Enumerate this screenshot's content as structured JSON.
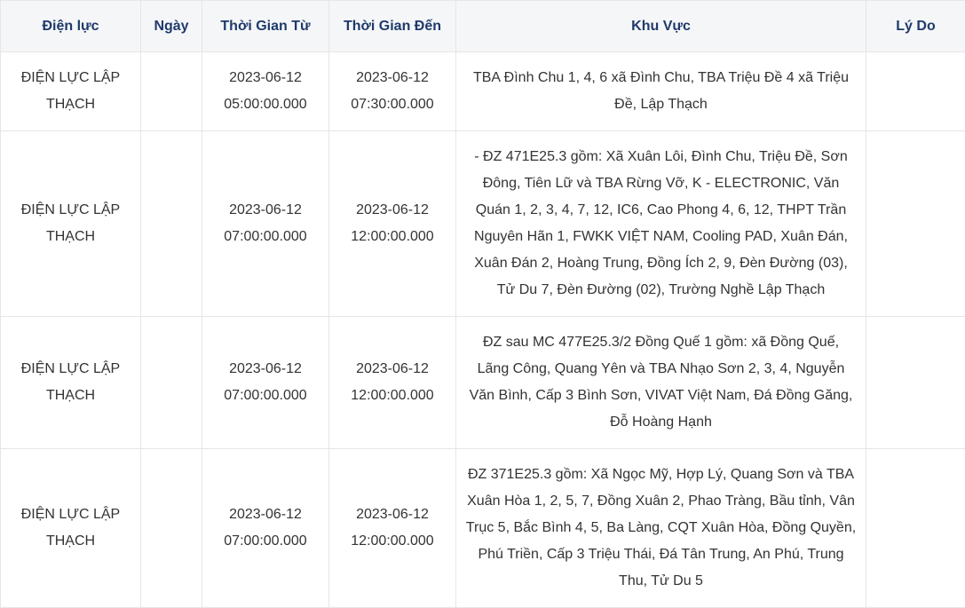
{
  "table": {
    "headers": [
      "Điện lực",
      "Ngày",
      "Thời Gian Từ",
      "Thời Gian Đến",
      "Khu Vực",
      "Lý Do"
    ],
    "rows": [
      {
        "dien_luc": "ĐIỆN LỰC LẬP THẠCH",
        "ngay": "",
        "tu_date": "2023-06-12",
        "tu_time": "05:00:00.000",
        "den_date": "2023-06-12",
        "den_time": "07:30:00.000",
        "khu_vuc": "TBA Đình Chu 1, 4, 6 xã Đình Chu, TBA Triệu Đề 4 xã Triệu Đề, Lập Thạch",
        "ly_do": ""
      },
      {
        "dien_luc": "ĐIỆN LỰC LẬP THẠCH",
        "ngay": "",
        "tu_date": "2023-06-12",
        "tu_time": "07:00:00.000",
        "den_date": "2023-06-12",
        "den_time": "12:00:00.000",
        "khu_vuc": "- ĐZ 471E25.3 gồm: Xã Xuân Lôi, Đình Chu, Triệu Đề, Sơn Đông, Tiên Lữ và TBA Rừng Vỡ, K - ELECTRONIC, Văn Quán 1, 2, 3, 4, 7, 12, IC6, Cao Phong 4, 6, 12, THPT Trần Nguyên Hãn 1, FWKK VIỆT NAM, Cooling PAD, Xuân Đán, Xuân Đán 2, Hoàng Trung, Đồng Ích 2, 9, Đèn Đường (03), Tử Du 7, Đèn Đường (02), Trường Nghề Lập Thạch",
        "ly_do": ""
      },
      {
        "dien_luc": "ĐIỆN LỰC LẬP THẠCH",
        "ngay": "",
        "tu_date": "2023-06-12",
        "tu_time": "07:00:00.000",
        "den_date": "2023-06-12",
        "den_time": "12:00:00.000",
        "khu_vuc": "ĐZ sau MC 477E25.3/2 Đồng Quế 1 gồm: xã Đồng Quế, Lãng Công, Quang Yên và TBA Nhạo Sơn 2, 3, 4, Nguyễn Văn Bình, Cấp 3 Bình Sơn, VIVAT Việt Nam, Đá Đồng Găng, Đỗ Hoàng Hạnh",
        "ly_do": ""
      },
      {
        "dien_luc": "ĐIỆN LỰC LẬP THẠCH",
        "ngay": "",
        "tu_date": "2023-06-12",
        "tu_time": "07:00:00.000",
        "den_date": "2023-06-12",
        "den_time": "12:00:00.000",
        "khu_vuc": "ĐZ 371E25.3 gồm: Xã Ngọc Mỹ, Hợp Lý, Quang Sơn và TBA Xuân Hòa 1, 2, 5, 7, Đồng Xuân 2, Phao Tràng, Bầu tỉnh, Vân Trục 5, Bắc Bình 4, 5, Ba Làng, CQT Xuân Hòa, Đồng Quyền, Phú Triền, Cấp 3 Triệu Thái, Đá Tân Trung, An Phú, Trung Thu, Tử Du 5",
        "ly_do": ""
      }
    ]
  }
}
